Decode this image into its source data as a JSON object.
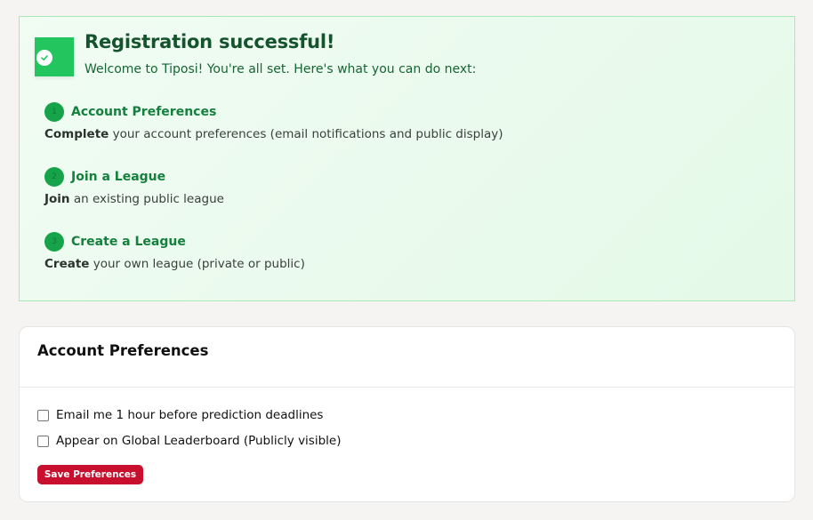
{
  "success": {
    "title": "Registration successful!",
    "subtitle": "Welcome to Tiposi! You're all set. Here's what you can do next:",
    "steps": [
      {
        "num": "1",
        "title": "Account Preferences",
        "bold": "Complete",
        "desc": " your account preferences (email notifications and public display)"
      },
      {
        "num": "2",
        "title": "Join a League",
        "bold": "Join",
        "desc": " an existing public league"
      },
      {
        "num": "3",
        "title": "Create a League",
        "bold": "Create",
        "desc": " your own league (private or public)"
      }
    ]
  },
  "preferences": {
    "title": "Account Preferences",
    "options": [
      {
        "label": "Email me 1 hour before prediction deadlines",
        "checked": false
      },
      {
        "label": "Appear on Global Leaderboard (Publicly visible)",
        "checked": false
      }
    ],
    "save_label": "Save Preferences"
  },
  "colors": {
    "accent_green": "#22c55e",
    "save_red": "#c8102e"
  }
}
